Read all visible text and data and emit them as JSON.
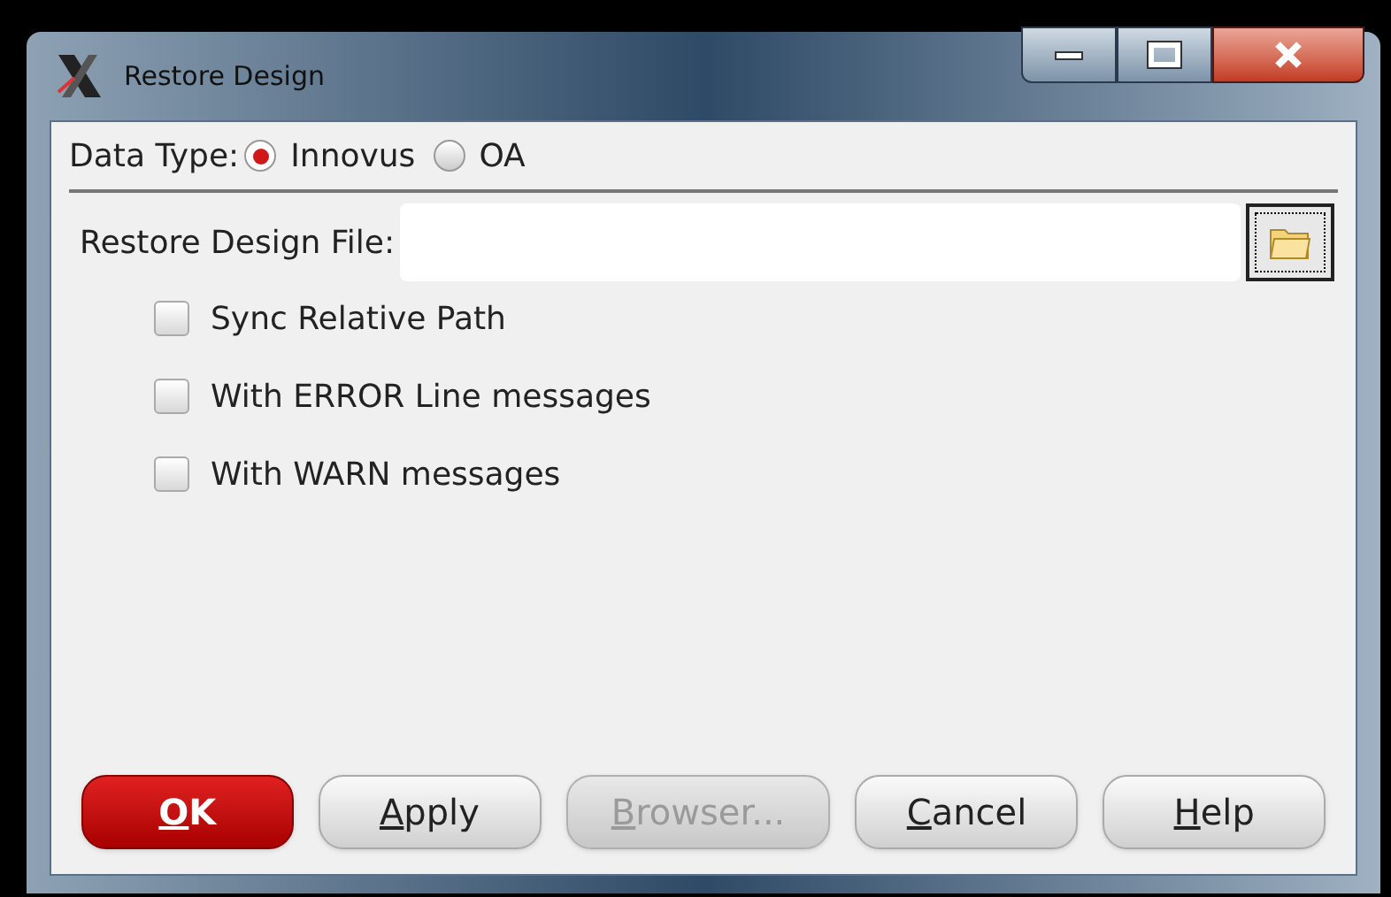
{
  "window": {
    "title": "Restore Design"
  },
  "data_type": {
    "label": "Data Type:",
    "options": [
      {
        "label": "Innovus",
        "selected": true
      },
      {
        "label": "OA",
        "selected": false
      }
    ]
  },
  "file_field": {
    "label": "Restore Design File:"
  },
  "checkboxes": [
    {
      "label": "Sync Relative Path",
      "checked": false
    },
    {
      "label": "With ERROR Line messages",
      "checked": false
    },
    {
      "label": "With WARN messages",
      "checked": false
    }
  ],
  "buttons": [
    {
      "mnemonic": "O",
      "rest": "K",
      "kind": "default",
      "disabled": false
    },
    {
      "mnemonic": "A",
      "rest": "pply",
      "kind": "normal",
      "disabled": false
    },
    {
      "mnemonic": "B",
      "rest": "rowser...",
      "kind": "normal",
      "disabled": true
    },
    {
      "mnemonic": "C",
      "rest": "ancel",
      "kind": "normal",
      "disabled": false
    },
    {
      "mnemonic": "H",
      "rest": "elp",
      "kind": "normal",
      "disabled": false
    }
  ]
}
